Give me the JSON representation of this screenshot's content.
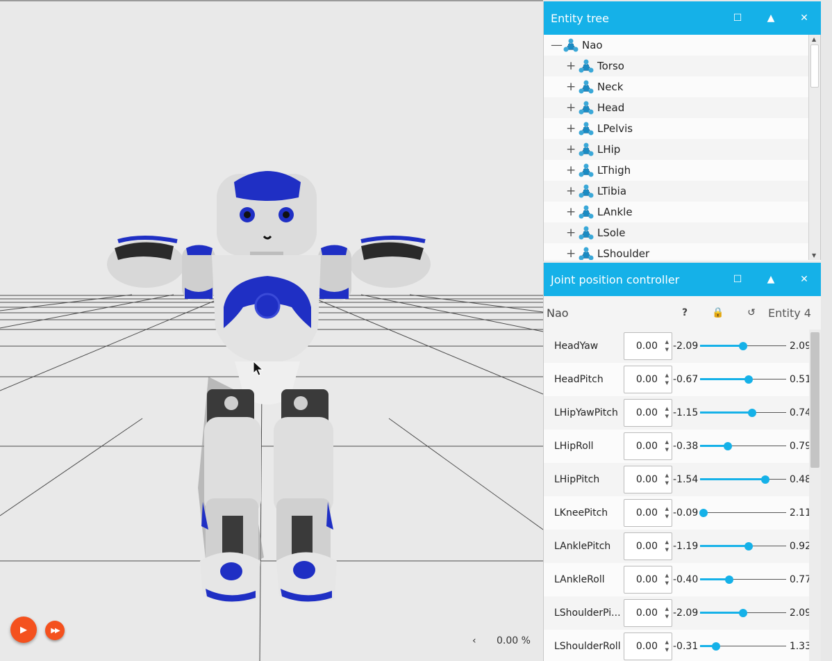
{
  "viewport": {
    "progress_text": "0.00 %",
    "play_icon": "play-icon",
    "fast_forward_icon": "fast-forward-icon",
    "collapse_icon": "chevron-left-icon",
    "accent": "#f4511e"
  },
  "entity_tree": {
    "title": "Entity tree",
    "accent": "#15b1e8",
    "root": {
      "label": "Nao",
      "toggle": "—"
    },
    "children": [
      {
        "label": "Torso",
        "toggle": "+"
      },
      {
        "label": "Neck",
        "toggle": "+"
      },
      {
        "label": "Head",
        "toggle": "+"
      },
      {
        "label": "LPelvis",
        "toggle": "+"
      },
      {
        "label": "LHip",
        "toggle": "+"
      },
      {
        "label": "LThigh",
        "toggle": "+"
      },
      {
        "label": "LTibia",
        "toggle": "+"
      },
      {
        "label": "LAnkle",
        "toggle": "+"
      },
      {
        "label": "LSole",
        "toggle": "+"
      },
      {
        "label": "LShoulder",
        "toggle": "+"
      }
    ]
  },
  "joint_controller": {
    "title": "Joint position controller",
    "entity_name": "Nao",
    "help_label": "?",
    "lock_icon": "lock-icon",
    "reset_icon": "reset-icon",
    "entity_label": "Entity 4",
    "joints": [
      {
        "name": "HeadYaw",
        "value": "0.00",
        "min": "-2.09",
        "max": "2.09",
        "fraction": 0.5
      },
      {
        "name": "HeadPitch",
        "value": "0.00",
        "min": "-0.67",
        "max": "0.51",
        "fraction": 0.568
      },
      {
        "name": "LHipYawPitch",
        "value": "0.00",
        "min": "-1.15",
        "max": "0.74",
        "fraction": 0.608
      },
      {
        "name": "LHipRoll",
        "value": "0.00",
        "min": "-0.38",
        "max": "0.79",
        "fraction": 0.325
      },
      {
        "name": "LHipPitch",
        "value": "0.00",
        "min": "-1.54",
        "max": "0.48",
        "fraction": 0.762
      },
      {
        "name": "LKneePitch",
        "value": "0.00",
        "min": "-0.09",
        "max": "2.11",
        "fraction": 0.041
      },
      {
        "name": "LAnklePitch",
        "value": "0.00",
        "min": "-1.19",
        "max": "0.92",
        "fraction": 0.564
      },
      {
        "name": "LAnkleRoll",
        "value": "0.00",
        "min": "-0.40",
        "max": "0.77",
        "fraction": 0.342
      },
      {
        "name": "LShoulderPi...",
        "value": "0.00",
        "min": "-2.09",
        "max": "2.09",
        "fraction": 0.5
      },
      {
        "name": "LShoulderRoll",
        "value": "0.00",
        "min": "-0.31",
        "max": "1.33",
        "fraction": 0.189
      }
    ]
  }
}
